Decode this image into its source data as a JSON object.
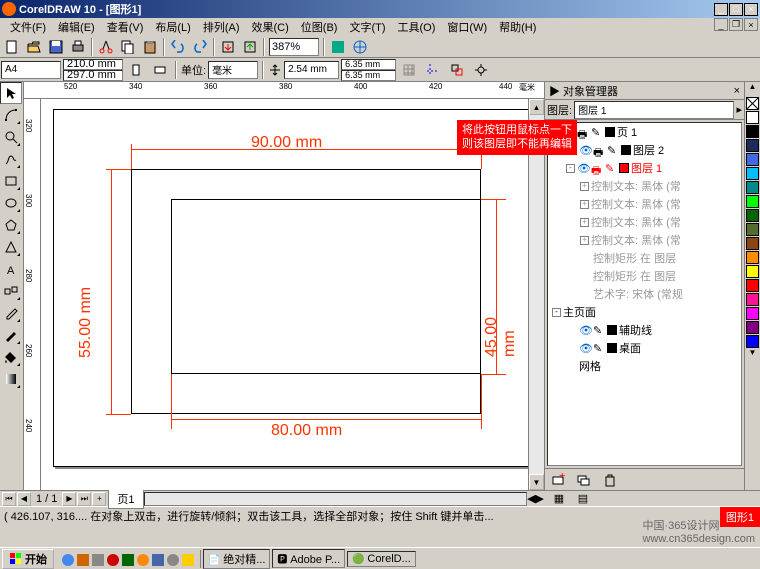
{
  "app": {
    "title": "CorelDRAW 10 - [图形1]"
  },
  "menu": [
    "文件(F)",
    "编辑(E)",
    "查看(V)",
    "布局(L)",
    "排列(A)",
    "效果(C)",
    "位图(B)",
    "文字(T)",
    "工具(O)",
    "窗口(W)",
    "帮助(H)"
  ],
  "zoom": "387%",
  "prop": {
    "paper": "A4",
    "w": "210.0 mm",
    "h": "297.0 mm",
    "units_label": "单位:",
    "units": "毫米",
    "nudge": "2.54 mm",
    "dupx": "6.35 mm",
    "dupy": "6.35 mm"
  },
  "ruler_h": [
    "520",
    "340",
    "360",
    "380",
    "400",
    "420",
    "440",
    "毫米"
  ],
  "ruler_v": [
    "320",
    "300",
    "280",
    "260",
    "240"
  ],
  "dims": {
    "top": "90.00 mm",
    "left": "55.00 mm",
    "right": "45.00 mm",
    "bottom": "80.00 mm"
  },
  "page_nav": {
    "cur": "1 / 1",
    "tab": "页1"
  },
  "docker": {
    "title": "▶ 对象管理器",
    "drop": "图层:",
    "drop_val": "图层 1",
    "tree": [
      {
        "lvl": 0,
        "exp": "-",
        "eye": true,
        "print": true,
        "pen": true,
        "color": "#000",
        "label": "页 1",
        "cls": ""
      },
      {
        "lvl": 1,
        "exp": "",
        "eye": true,
        "print": true,
        "pen": true,
        "color": "#000",
        "label": "图层 2",
        "cls": ""
      },
      {
        "lvl": 1,
        "exp": "-",
        "eye": true,
        "print": true,
        "pen": true,
        "color": "#f00",
        "label": "图层 1",
        "cls": "sel"
      },
      {
        "lvl": 2,
        "exp": "+",
        "eye": false,
        "print": false,
        "pen": false,
        "color": "",
        "label": "控制文本: 黑体 (常",
        "cls": "tree-grey"
      },
      {
        "lvl": 2,
        "exp": "+",
        "eye": false,
        "print": false,
        "pen": false,
        "color": "",
        "label": "控制文本: 黑体 (常",
        "cls": "tree-grey"
      },
      {
        "lvl": 2,
        "exp": "+",
        "eye": false,
        "print": false,
        "pen": false,
        "color": "",
        "label": "控制文本: 黑体 (常",
        "cls": "tree-grey"
      },
      {
        "lvl": 2,
        "exp": "+",
        "eye": false,
        "print": false,
        "pen": false,
        "color": "",
        "label": "控制文本: 黑体 (常",
        "cls": "tree-grey"
      },
      {
        "lvl": 2,
        "exp": "",
        "eye": false,
        "print": false,
        "pen": false,
        "color": "",
        "label": "控制矩形 在 图层",
        "cls": "tree-grey"
      },
      {
        "lvl": 2,
        "exp": "",
        "eye": false,
        "print": false,
        "pen": false,
        "color": "",
        "label": "控制矩形 在 图层",
        "cls": "tree-grey"
      },
      {
        "lvl": 2,
        "exp": "",
        "eye": false,
        "print": false,
        "pen": false,
        "color": "",
        "label": "艺术字: 宋体 (常规",
        "cls": "tree-grey"
      },
      {
        "lvl": 0,
        "exp": "-",
        "eye": false,
        "print": false,
        "pen": false,
        "color": "",
        "label": "主页面",
        "cls": ""
      },
      {
        "lvl": 1,
        "exp": "",
        "eye": true,
        "print": false,
        "pen": true,
        "color": "#000",
        "label": "辅助线",
        "cls": ""
      },
      {
        "lvl": 1,
        "exp": "",
        "eye": true,
        "print": false,
        "pen": true,
        "color": "#000",
        "label": "桌面",
        "cls": ""
      },
      {
        "lvl": 1,
        "exp": "",
        "eye": false,
        "print": false,
        "pen": false,
        "color": "",
        "label": "网格",
        "cls": ""
      }
    ]
  },
  "palette_colors": [
    "#ffffff",
    "#000000",
    "#1a2c5b",
    "#4169e1",
    "#00bfff",
    "#008b8b",
    "#00ff00",
    "#006400",
    "#556b2f",
    "#8b4513",
    "#ff8c00",
    "#ffff00",
    "#ff0000",
    "#ff1493",
    "#ff00ff",
    "#800080",
    "#0000ff"
  ],
  "callout": {
    "l1": "将此按钮用鼠标点一下",
    "l2": "则该图层即不能再编辑"
  },
  "status": "( 426.107, 316....   在对象上双击，进行旋转/倾斜；双击该工具，选择全部对象；按住 Shift 键并单击...",
  "taskbar": {
    "start": "开始",
    "items": [
      "绝对精...",
      "Adobe P...",
      "CorelD..."
    ]
  },
  "watermark": {
    "l1": "中国·365设计网",
    "l2": "www.cn365design.com"
  },
  "redtab": "图形1"
}
